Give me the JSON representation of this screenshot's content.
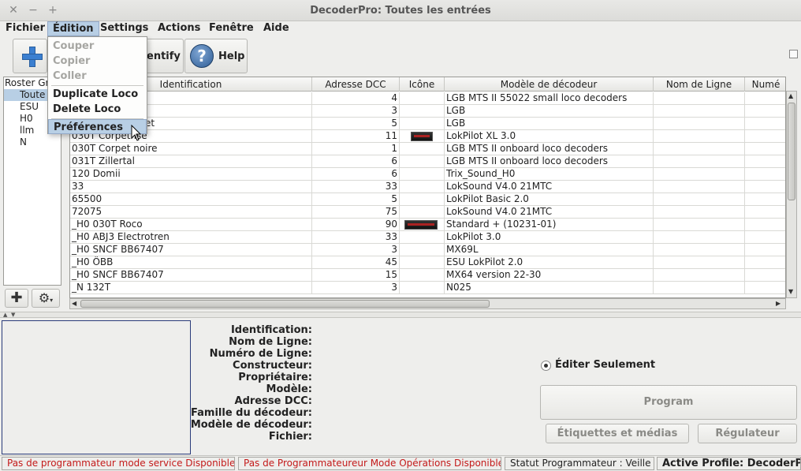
{
  "window": {
    "title": "DecoderPro: Toutes les entrées",
    "close": "✕",
    "minimize": "−",
    "maximize": "+"
  },
  "menubar": [
    "Fichier",
    "Édition",
    "Settings",
    "Actions",
    "Fenêtre",
    "Aide"
  ],
  "edit_menu": {
    "items": [
      "Couper",
      "Copier",
      "Coller",
      "Duplicate Loco",
      "Delete Loco",
      "Préférences"
    ]
  },
  "toolbar": {
    "identify": "Identify",
    "identify_visible": "entify",
    "help": "Help",
    "help_glyph": "?"
  },
  "roster_groups": {
    "header": "Roster Gr",
    "items": [
      "Toute",
      "ESU",
      "H0",
      "llm",
      "N"
    ]
  },
  "table": {
    "columns": [
      "Identification",
      "Adresse DCC",
      "Icône",
      "Modèle de décodeur",
      "Nom de Ligne",
      "Numé"
    ],
    "rows": [
      {
        "id": "",
        "dcc": "4",
        "icon": "",
        "model": "LGB MTS II 55022 small loco decoders"
      },
      {
        "id": "",
        "dcc": "3",
        "icon": "",
        "model": "LGB"
      },
      {
        "id": "et",
        "dcc": "5",
        "icon": "",
        "model": "LGB"
      },
      {
        "id": "030T Corpet",
        "id_tail": "nse",
        "dcc": "11",
        "icon": "loco",
        "model": "LokPilot XL 3.0"
      },
      {
        "id": "030T Corpet noire",
        "dcc": "1",
        "icon": "",
        "model": "LGB MTS II onboard loco decoders"
      },
      {
        "id": "031T Zillertal",
        "dcc": "6",
        "icon": "",
        "model": "LGB MTS II onboard loco decoders"
      },
      {
        "id": "120 Domii",
        "dcc": "6",
        "icon": "",
        "model": "Trix_Sound_H0"
      },
      {
        "id": "33",
        "dcc": "33",
        "icon": "",
        "model": "LokSound V4.0 21MTC"
      },
      {
        "id": "65500",
        "dcc": "5",
        "icon": "",
        "model": "LokPilot Basic 2.0"
      },
      {
        "id": "72075",
        "dcc": "75",
        "icon": "",
        "model": "LokSound V4.0 21MTC"
      },
      {
        "id": "_H0 030T Roco",
        "dcc": "90",
        "icon": "loco",
        "model": "Standard + (10231-01)"
      },
      {
        "id": "_H0 ABJ3 Electrotren",
        "dcc": "33",
        "icon": "",
        "model": "LokPilot 3.0"
      },
      {
        "id": "_H0 SNCF BB67407",
        "dcc": "3",
        "icon": "",
        "model": "MX69L"
      },
      {
        "id": "_H0 ÖBB",
        "dcc": "45",
        "icon": "",
        "model": "ESU LokPilot 2.0"
      },
      {
        "id": "_H0 SNCF BB67407",
        "dcc": "15",
        "icon": "",
        "model": "MX64 version 22-30"
      },
      {
        "id": "_N 132T",
        "dcc": "3",
        "icon": "",
        "model": "N025"
      }
    ]
  },
  "details": {
    "labels": [
      "Identification:",
      "Nom de Ligne:",
      "Numéro de Ligne:",
      "Constructeur:",
      "Propriétaire:",
      "Modèle:",
      "Adresse DCC:",
      "Famille du décodeur:",
      "Modèle de décodeur:",
      "Fichier:"
    ],
    "edit_only": "Éditer Seulement",
    "program": "Program",
    "labels_media": "Étiquettes et médias",
    "throttle": "Régulateur"
  },
  "statusbar": {
    "service": "Pas de programmateur mode service Disponible",
    "ops": "Pas de Programmateureur Mode Opérations Disponible",
    "status": "Statut Programmateur : Veille",
    "profile": "Active Profile: DecoderPro"
  },
  "colors": {
    "menu_highlight": "#b8cfe5",
    "status_error": "#c41a1a",
    "accent_blue": "#3b7fd0"
  }
}
